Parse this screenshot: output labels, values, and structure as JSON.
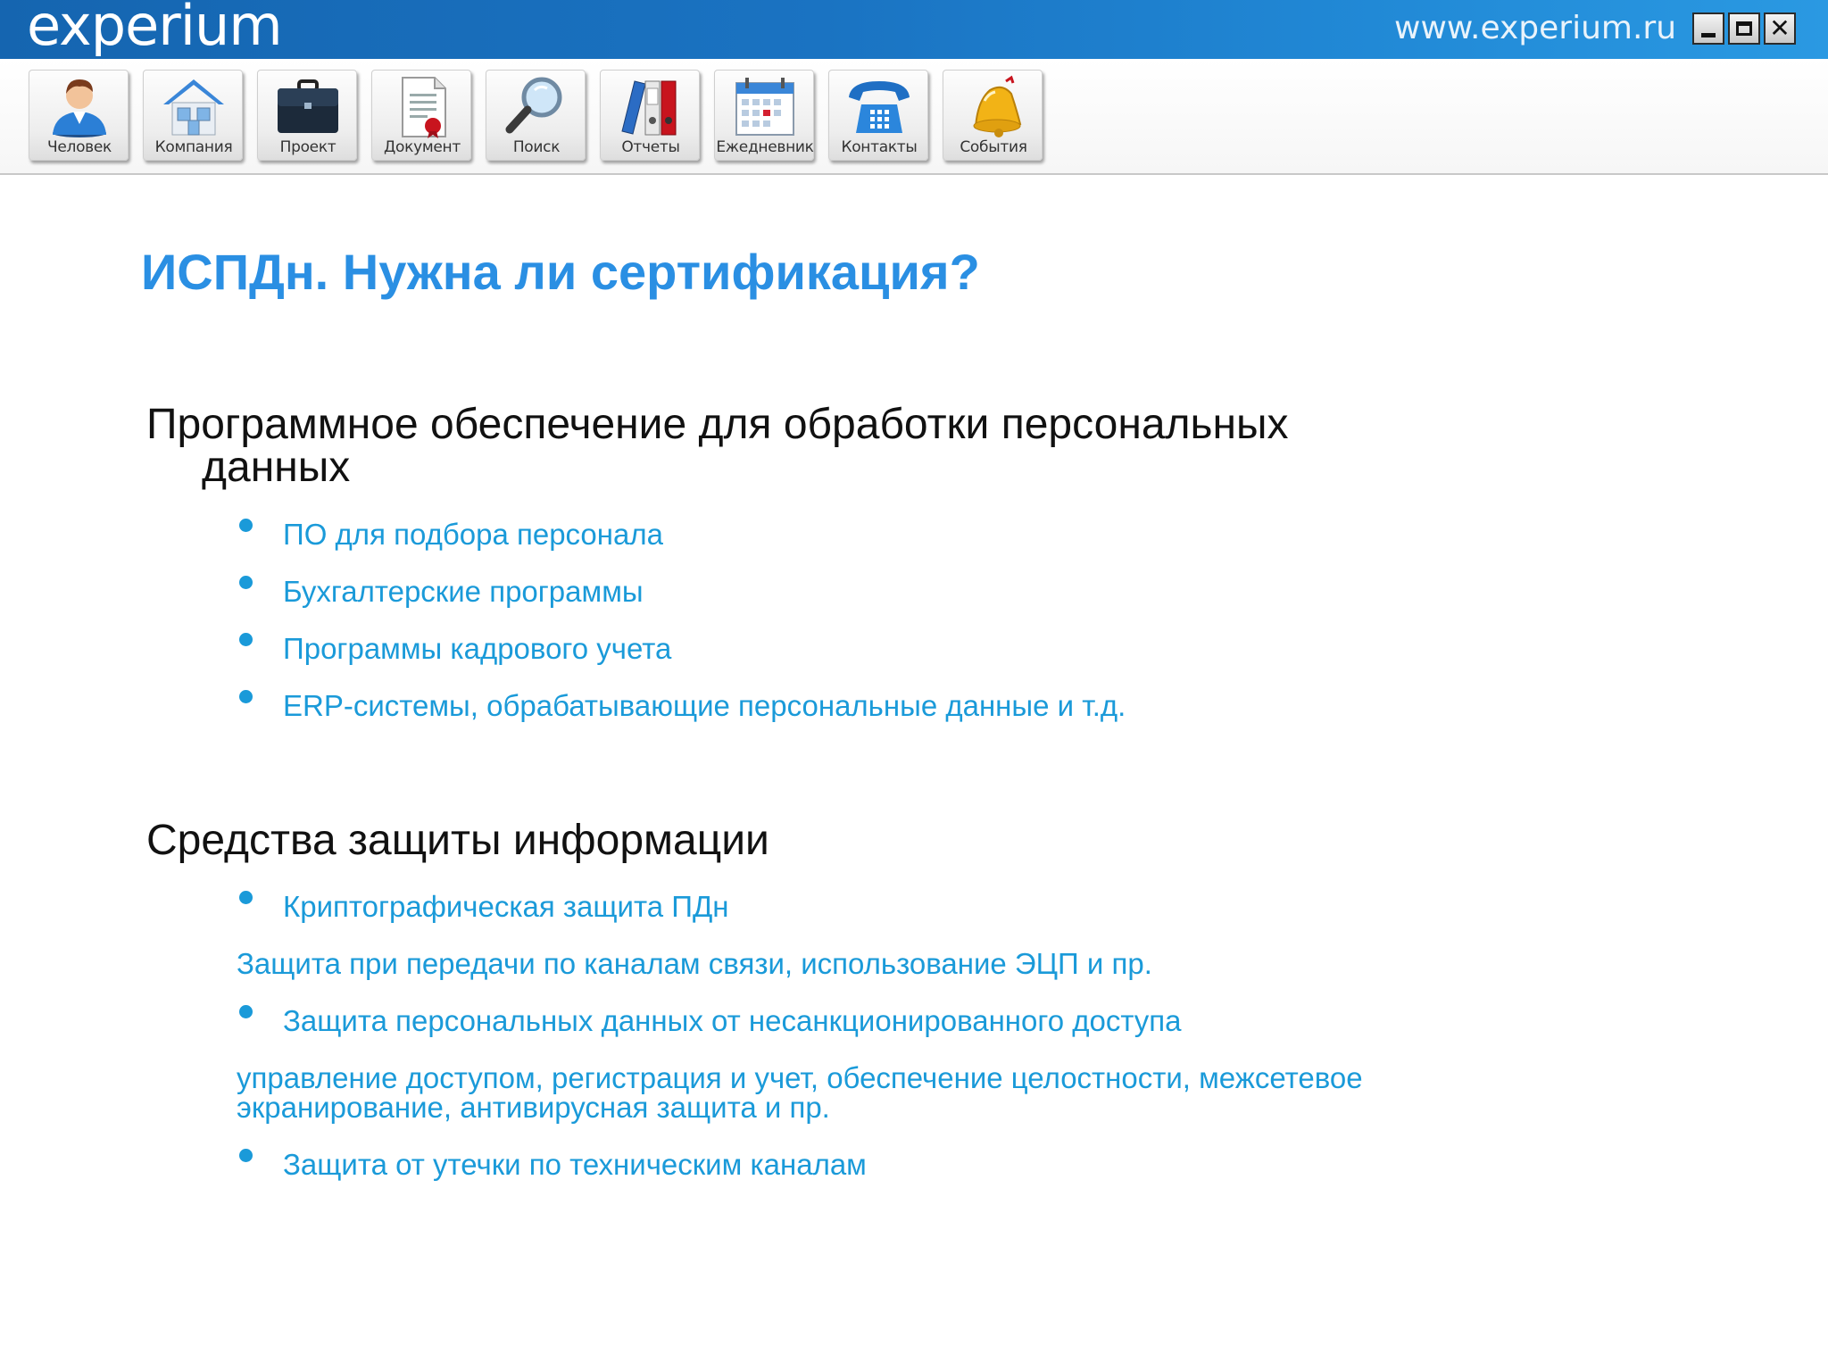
{
  "app": {
    "logo_text": "experium",
    "site_url": "www.experium.ru"
  },
  "toolbar": {
    "items": [
      {
        "label": "Человек",
        "icon": "person-icon"
      },
      {
        "label": "Компания",
        "icon": "house-icon"
      },
      {
        "label": "Проект",
        "icon": "briefcase-icon"
      },
      {
        "label": "Документ",
        "icon": "document-icon"
      },
      {
        "label": "Поиск",
        "icon": "magnifier-icon"
      },
      {
        "label": "Отчеты",
        "icon": "binders-icon"
      },
      {
        "label": "Ежедневник",
        "icon": "calendar-icon"
      },
      {
        "label": "Контакты",
        "icon": "telephone-icon"
      },
      {
        "label": "События",
        "icon": "bell-icon"
      }
    ]
  },
  "slide": {
    "title": "ИСПДн. Нужна ли сертификация?",
    "section1": {
      "heading_line1": "Программное обеспечение для  обработки персональных",
      "heading_line2": "данных",
      "items": [
        "ПО для подбора персонала",
        "Бухгалтерские программы",
        "Программы кадрового учета",
        "ERP-системы, обрабатывающие персональные данные и т.д."
      ]
    },
    "section2": {
      "heading": "Средства защиты информации",
      "bullet1": "Криптографическая защита ПДн",
      "note1": "Защита при передачи по каналам связи, использование ЭЦП и пр.",
      "bullet2": "Защита персональных данных от несанкционированного  доступа",
      "note2_line1": "управление доступом, регистрация и учет, обеспечение целостности, межсетевое",
      "note2_line2": "экранирование, антивирусная защита и пр.",
      "bullet3": "Защита от утечки по техническим каналам"
    }
  },
  "colors": {
    "title_blue": "#2a8fe3",
    "item_blue": "#1a9ad9",
    "titlebar_blue": "#1a73c2"
  }
}
